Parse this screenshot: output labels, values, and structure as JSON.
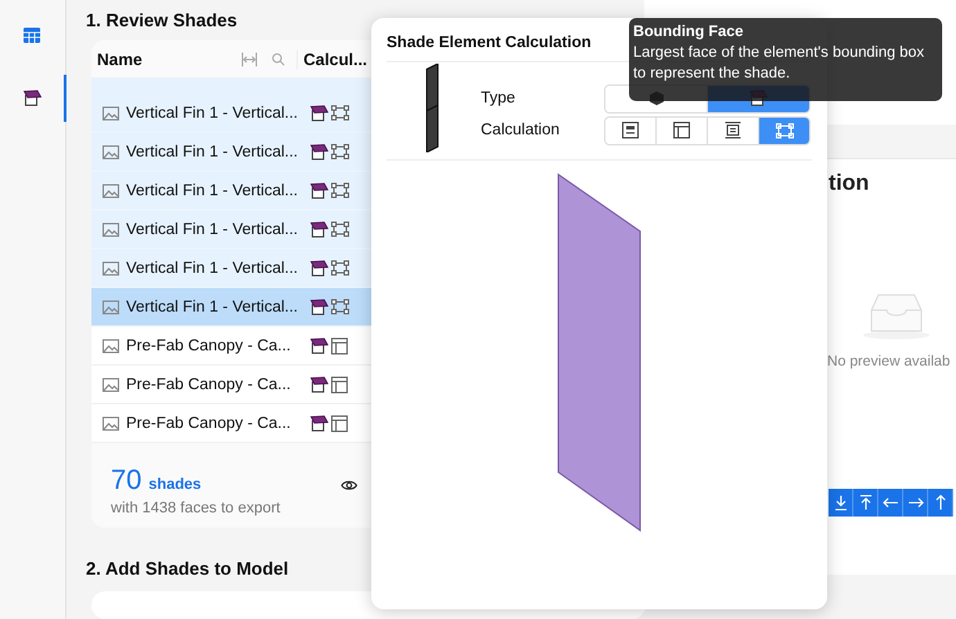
{
  "rail": {
    "items": [
      {
        "kind": "table",
        "selected": false
      },
      {
        "kind": "shade",
        "selected": true
      }
    ]
  },
  "review": {
    "title": "1. Review Shades",
    "columns": [
      {
        "label": "Name"
      },
      {
        "label": "Calcul..."
      }
    ],
    "rows": [
      {
        "name": "Vertical Fin 1 - Vertical...",
        "kind": "bounding",
        "selected": true,
        "active": false
      },
      {
        "name": "Vertical Fin 1 - Vertical...",
        "kind": "bounding",
        "selected": true,
        "active": false
      },
      {
        "name": "Vertical Fin 1 - Vertical...",
        "kind": "bounding",
        "selected": true,
        "active": false
      },
      {
        "name": "Vertical Fin 1 - Vertical...",
        "kind": "bounding",
        "selected": true,
        "active": false
      },
      {
        "name": "Vertical Fin 1 - Vertical...",
        "kind": "bounding",
        "selected": true,
        "active": false
      },
      {
        "name": "Vertical Fin 1 - Vertical...",
        "kind": "bounding",
        "selected": true,
        "active": true
      },
      {
        "name": "Pre-Fab Canopy - Ca...",
        "kind": "panel",
        "selected": false,
        "active": false
      },
      {
        "name": "Pre-Fab Canopy - Ca...",
        "kind": "panel",
        "selected": false,
        "active": false
      },
      {
        "name": "Pre-Fab Canopy - Ca...",
        "kind": "panel",
        "selected": false,
        "active": false
      }
    ],
    "count": "70",
    "count_unit": "shades",
    "summary": "with 1438 faces to export"
  },
  "add": {
    "title": "2. Add Shades to Model"
  },
  "popover": {
    "title": "Shade Element Calculation",
    "type_label": "Type",
    "calculation_label": "Calculation",
    "type_options": [
      {
        "kind": "solid",
        "selected": false
      },
      {
        "kind": "shade",
        "selected": true
      }
    ],
    "calculation_options": [
      {
        "kind": "center",
        "selected": false
      },
      {
        "kind": "panel",
        "selected": false
      },
      {
        "kind": "frame",
        "selected": false
      },
      {
        "kind": "bounding",
        "selected": true
      }
    ]
  },
  "tooltip": {
    "title": "Bounding Face",
    "text": "Largest face of the element's bounding box to represent the shade."
  },
  "preview": {
    "title": "tion",
    "empty_text": "No preview availab",
    "tools": [
      {
        "kind": "download"
      },
      {
        "kind": "top"
      },
      {
        "kind": "left"
      },
      {
        "kind": "right"
      },
      {
        "kind": "up"
      }
    ]
  }
}
